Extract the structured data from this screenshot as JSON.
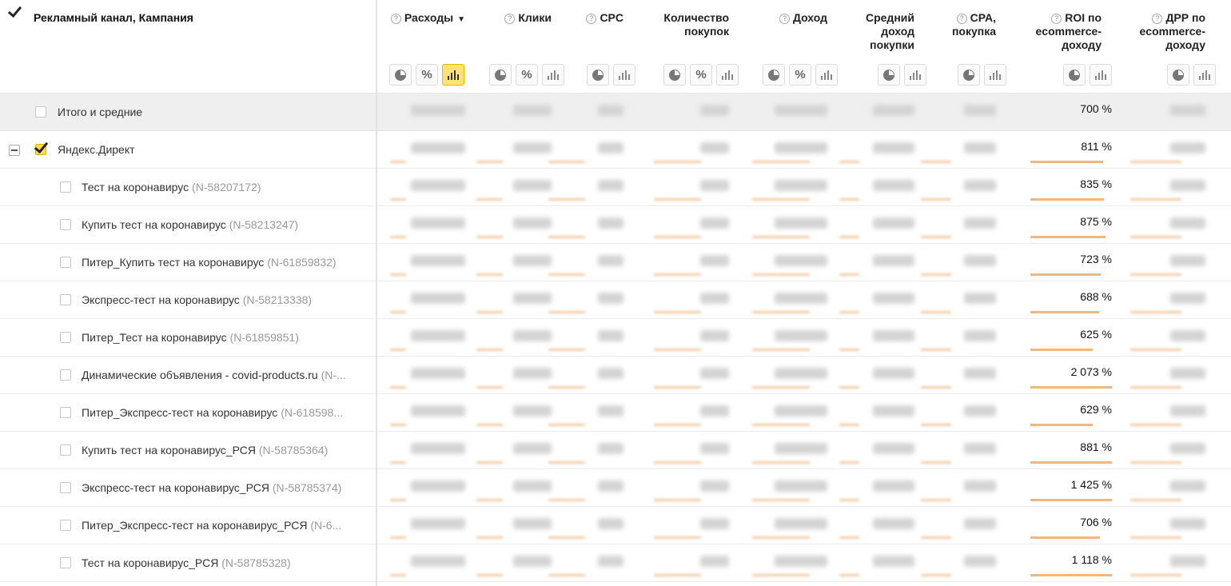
{
  "header": {
    "campaign_column_title": "Рекламный канал, Кампания",
    "columns": [
      {
        "key": "spend",
        "title": "Расходы",
        "sort_indicator": "▼",
        "buttons": [
          "pie-icon",
          "percent-icon",
          "bars-icon"
        ],
        "active_button": "bars-icon"
      },
      {
        "key": "clicks",
        "title": "Клики",
        "buttons": [
          "pie-icon",
          "percent-icon",
          "bars-icon"
        ]
      },
      {
        "key": "cpc",
        "title": "CPC",
        "buttons": [
          "pie-icon",
          "bars-icon"
        ]
      },
      {
        "key": "purchases",
        "title": "Количество покупок",
        "buttons": [
          "pie-icon",
          "percent-icon",
          "bars-icon"
        ]
      },
      {
        "key": "revenue",
        "title": "Доход",
        "buttons": [
          "pie-icon",
          "percent-icon",
          "bars-icon"
        ]
      },
      {
        "key": "avg_revenue",
        "title": "Средний доход покупки",
        "buttons": [
          "pie-icon",
          "bars-icon"
        ]
      },
      {
        "key": "cpa",
        "title": "CPA, покупка",
        "buttons": [
          "pie-icon",
          "bars-icon"
        ]
      },
      {
        "key": "roi",
        "title": "ROI по ecommerce-доходу",
        "buttons": [
          "pie-icon",
          "bars-icon"
        ]
      },
      {
        "key": "drr",
        "title": "ДРР по ecommerce-доходу",
        "buttons": [
          "pie-icon",
          "bars-icon"
        ]
      }
    ],
    "help_glyph": "?",
    "percent_glyph": "%"
  },
  "total_row": {
    "label": "Итого и средние",
    "roi": "700 %"
  },
  "group_row": {
    "label": "Яндекс.Директ",
    "roi": "811 %",
    "roi_bar_fraction": 0.89
  },
  "campaigns": [
    {
      "name": "Тест на коронавирус",
      "id": "(N-58207172)",
      "roi": "835 %",
      "roi_bar_fraction": 0.9
    },
    {
      "name": "Купить тест на коронавирус",
      "id": "(N-58213247)",
      "roi": "875 %",
      "roi_bar_fraction": 0.92
    },
    {
      "name": "Питер_Купить тест на коронавирус",
      "id": "(N-61859832)",
      "roi": "723 %",
      "roi_bar_fraction": 0.86
    },
    {
      "name": "Экспресс-тест на коронавирус",
      "id": "(N-58213338)",
      "roi": "688 %",
      "roi_bar_fraction": 0.84
    },
    {
      "name": "Питер_Тест на коронавирус",
      "id": "(N-61859851)",
      "roi": "625 %",
      "roi_bar_fraction": 0.76
    },
    {
      "name": "Динамические объявления - covid-products.ru",
      "id": "(N-...",
      "roi": "2 073 %",
      "roi_bar_fraction": 1.0
    },
    {
      "name": "Питер_Экспресс-тест на коронавирус",
      "id": "(N-618598...",
      "roi": "629 %",
      "roi_bar_fraction": 0.76
    },
    {
      "name": "Купить тест на коронавирус_РСЯ",
      "id": "(N-58785364)",
      "roi": "881 %",
      "roi_bar_fraction": 1.0
    },
    {
      "name": "Экспресс-тест на коронавирус_РСЯ",
      "id": "(N-58785374)",
      "roi": "1 425 %",
      "roi_bar_fraction": 1.0
    },
    {
      "name": "Питер_Экспресс-тест на коронавирус_РСЯ",
      "id": "(N-6...",
      "roi": "706 %",
      "roi_bar_fraction": 0.85
    },
    {
      "name": "Тест на коронавирус_РСЯ",
      "id": "(N-58785328)",
      "roi": "1 118 %",
      "roi_bar_fraction": 1.0
    }
  ],
  "colors": {
    "checkbox_accent": "#ffdb4d",
    "roi_bar": "#f0b87c",
    "total_row_bg": "#efefef"
  }
}
